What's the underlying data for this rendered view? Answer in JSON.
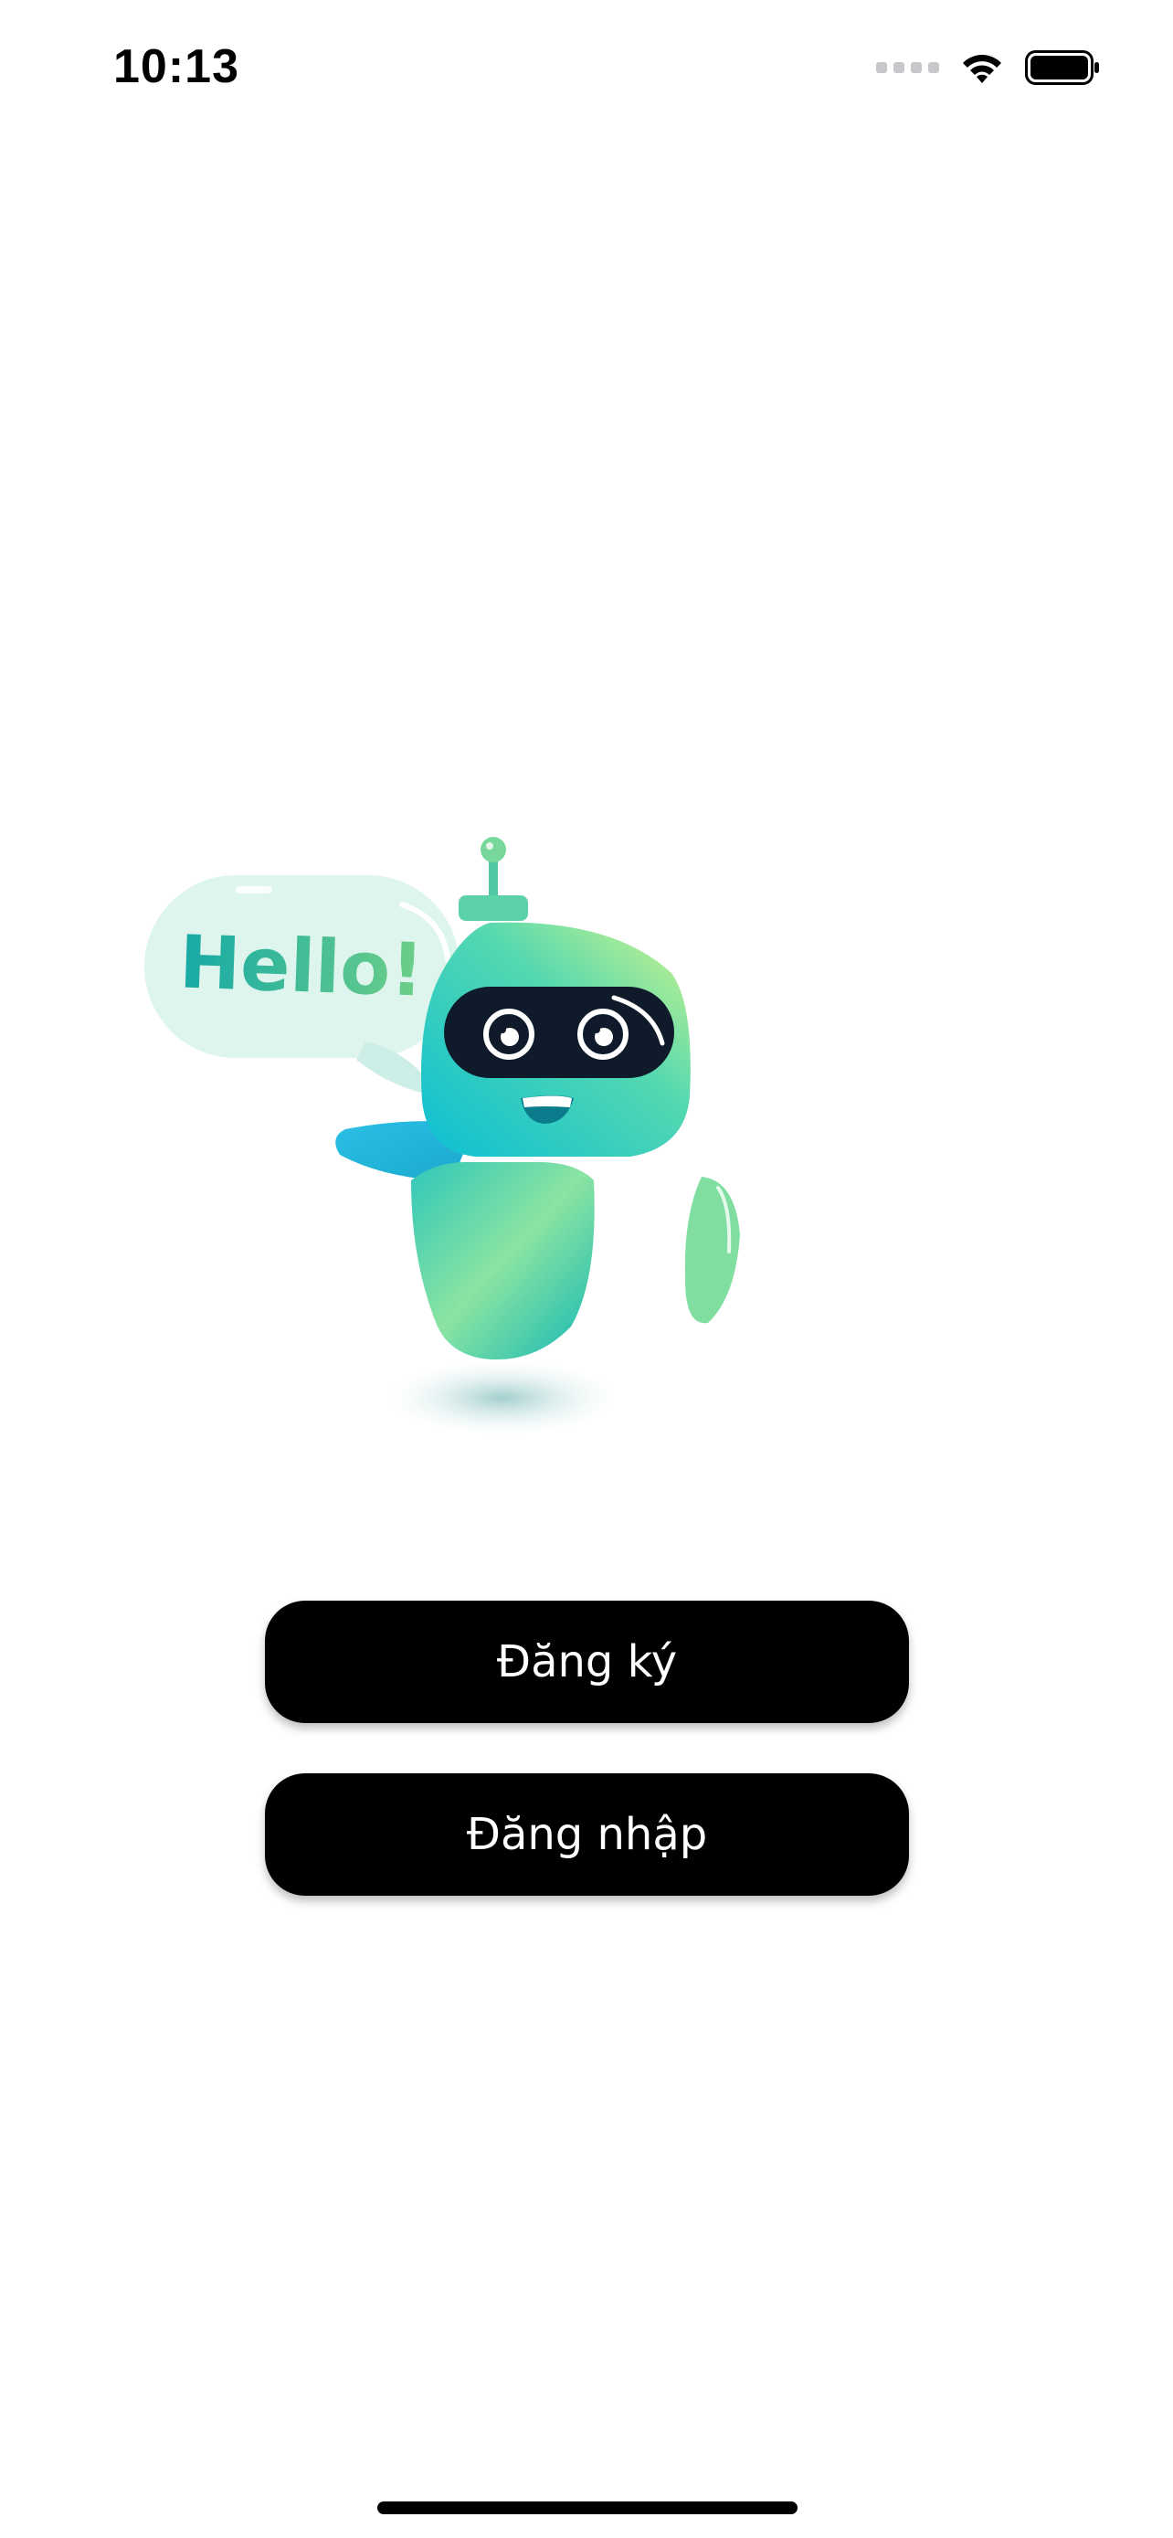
{
  "status_bar": {
    "time": "10:13",
    "icons": [
      "cellular-signal-icon",
      "wifi-icon",
      "battery-icon"
    ]
  },
  "illustration": {
    "speech_bubble_text": "Hello!",
    "colors": {
      "robot_teal": "#14c3c9",
      "robot_green": "#8ee39f",
      "bubble": "#d9f5ea",
      "visor": "#0f1b2a"
    }
  },
  "actions": {
    "register_label": "Đăng ký",
    "login_label": "Đăng nhập"
  },
  "theme": {
    "background": "#ffffff",
    "button_background": "#000000",
    "button_text": "#ffffff"
  }
}
